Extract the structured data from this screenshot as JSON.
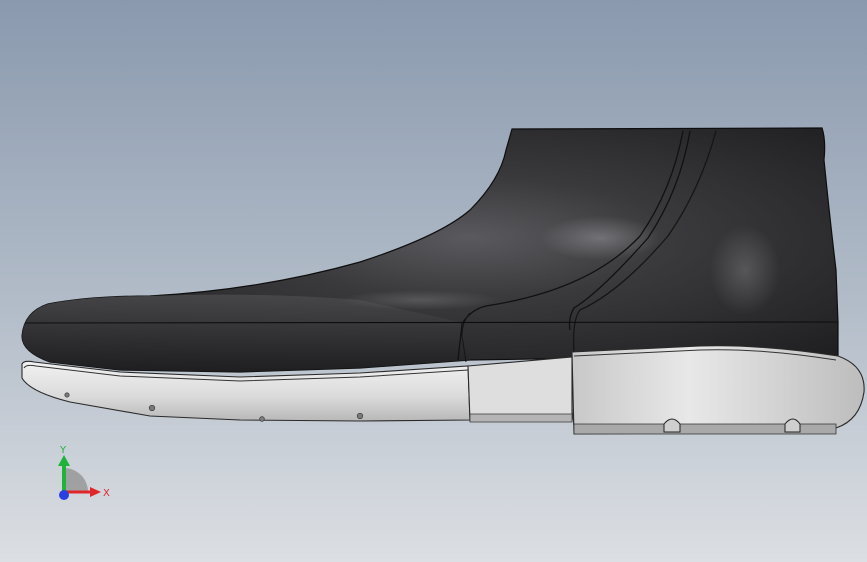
{
  "viewport": {
    "background_top": "#8b9bb0",
    "background_bottom": "#d9dde2"
  },
  "model": {
    "upper_color": "#2b2b2d",
    "upper_highlight": "#6a6a6e",
    "sole_color": "#d9d9d9",
    "sole_shadow": "#9a9a9a",
    "edge_color": "#111111"
  },
  "triad": {
    "y_label": "Y",
    "x_label": "X",
    "y_color": "#1fb33a",
    "x_color": "#e0262a",
    "z_color": "#2a3fe0"
  }
}
